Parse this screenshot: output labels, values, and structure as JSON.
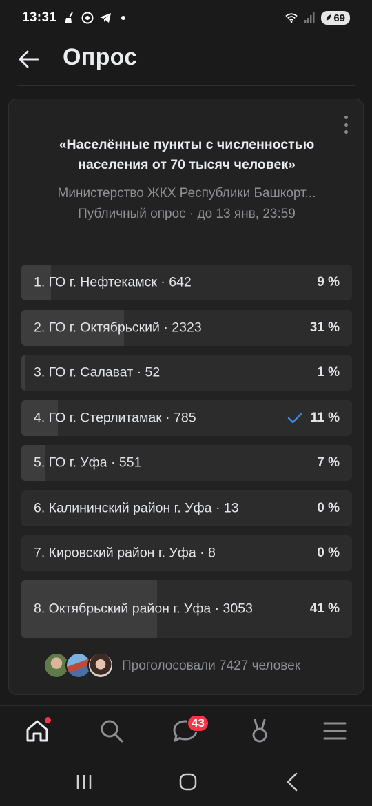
{
  "status_bar": {
    "time": "13:31",
    "battery": "69"
  },
  "header": {
    "title": "Опрос"
  },
  "poll": {
    "title": "«Населённые пункты с численностью населения от 70 тысяч человек»",
    "author": "Министерство ЖКХ Республики Башкорт...",
    "meta": "Публичный опрос · до 13 янв, 23:59",
    "options": [
      {
        "text": "1. ГО г. Нефтекамск",
        "count": " · 642",
        "percent": "9 %",
        "share": 0.09,
        "selected": false
      },
      {
        "text": "2. ГО г. Октябрьский",
        "count": " · 2323",
        "percent": "31 %",
        "share": 0.31,
        "selected": false
      },
      {
        "text": "3. ГО г. Салават",
        "count": " · 52",
        "percent": "1 %",
        "share": 0.01,
        "selected": false
      },
      {
        "text": "4. ГО г. Стерлитамак",
        "count": " · 785",
        "percent": "11 %",
        "share": 0.11,
        "selected": true
      },
      {
        "text": "5. ГО г. Уфа",
        "count": " · 551",
        "percent": "7 %",
        "share": 0.07,
        "selected": false
      },
      {
        "text": "6. Калининский район г. Уфа",
        "count": " · 13",
        "percent": "0 %",
        "share": 0.0,
        "selected": false
      },
      {
        "text": "7. Кировский район г. Уфа",
        "count": " · 8",
        "percent": "0 %",
        "share": 0.0,
        "selected": false
      },
      {
        "text": "8. Октябрьский район г. Уфа",
        "count": " · 3053",
        "percent": "41 %",
        "share": 0.41,
        "selected": false
      }
    ],
    "voters_text": "Проголосовали 7427 человек"
  },
  "tabbar": {
    "messages_badge": "43"
  },
  "colors": {
    "accent": "#3f8ae0",
    "badge": "#ff3347",
    "card": "#222222"
  }
}
